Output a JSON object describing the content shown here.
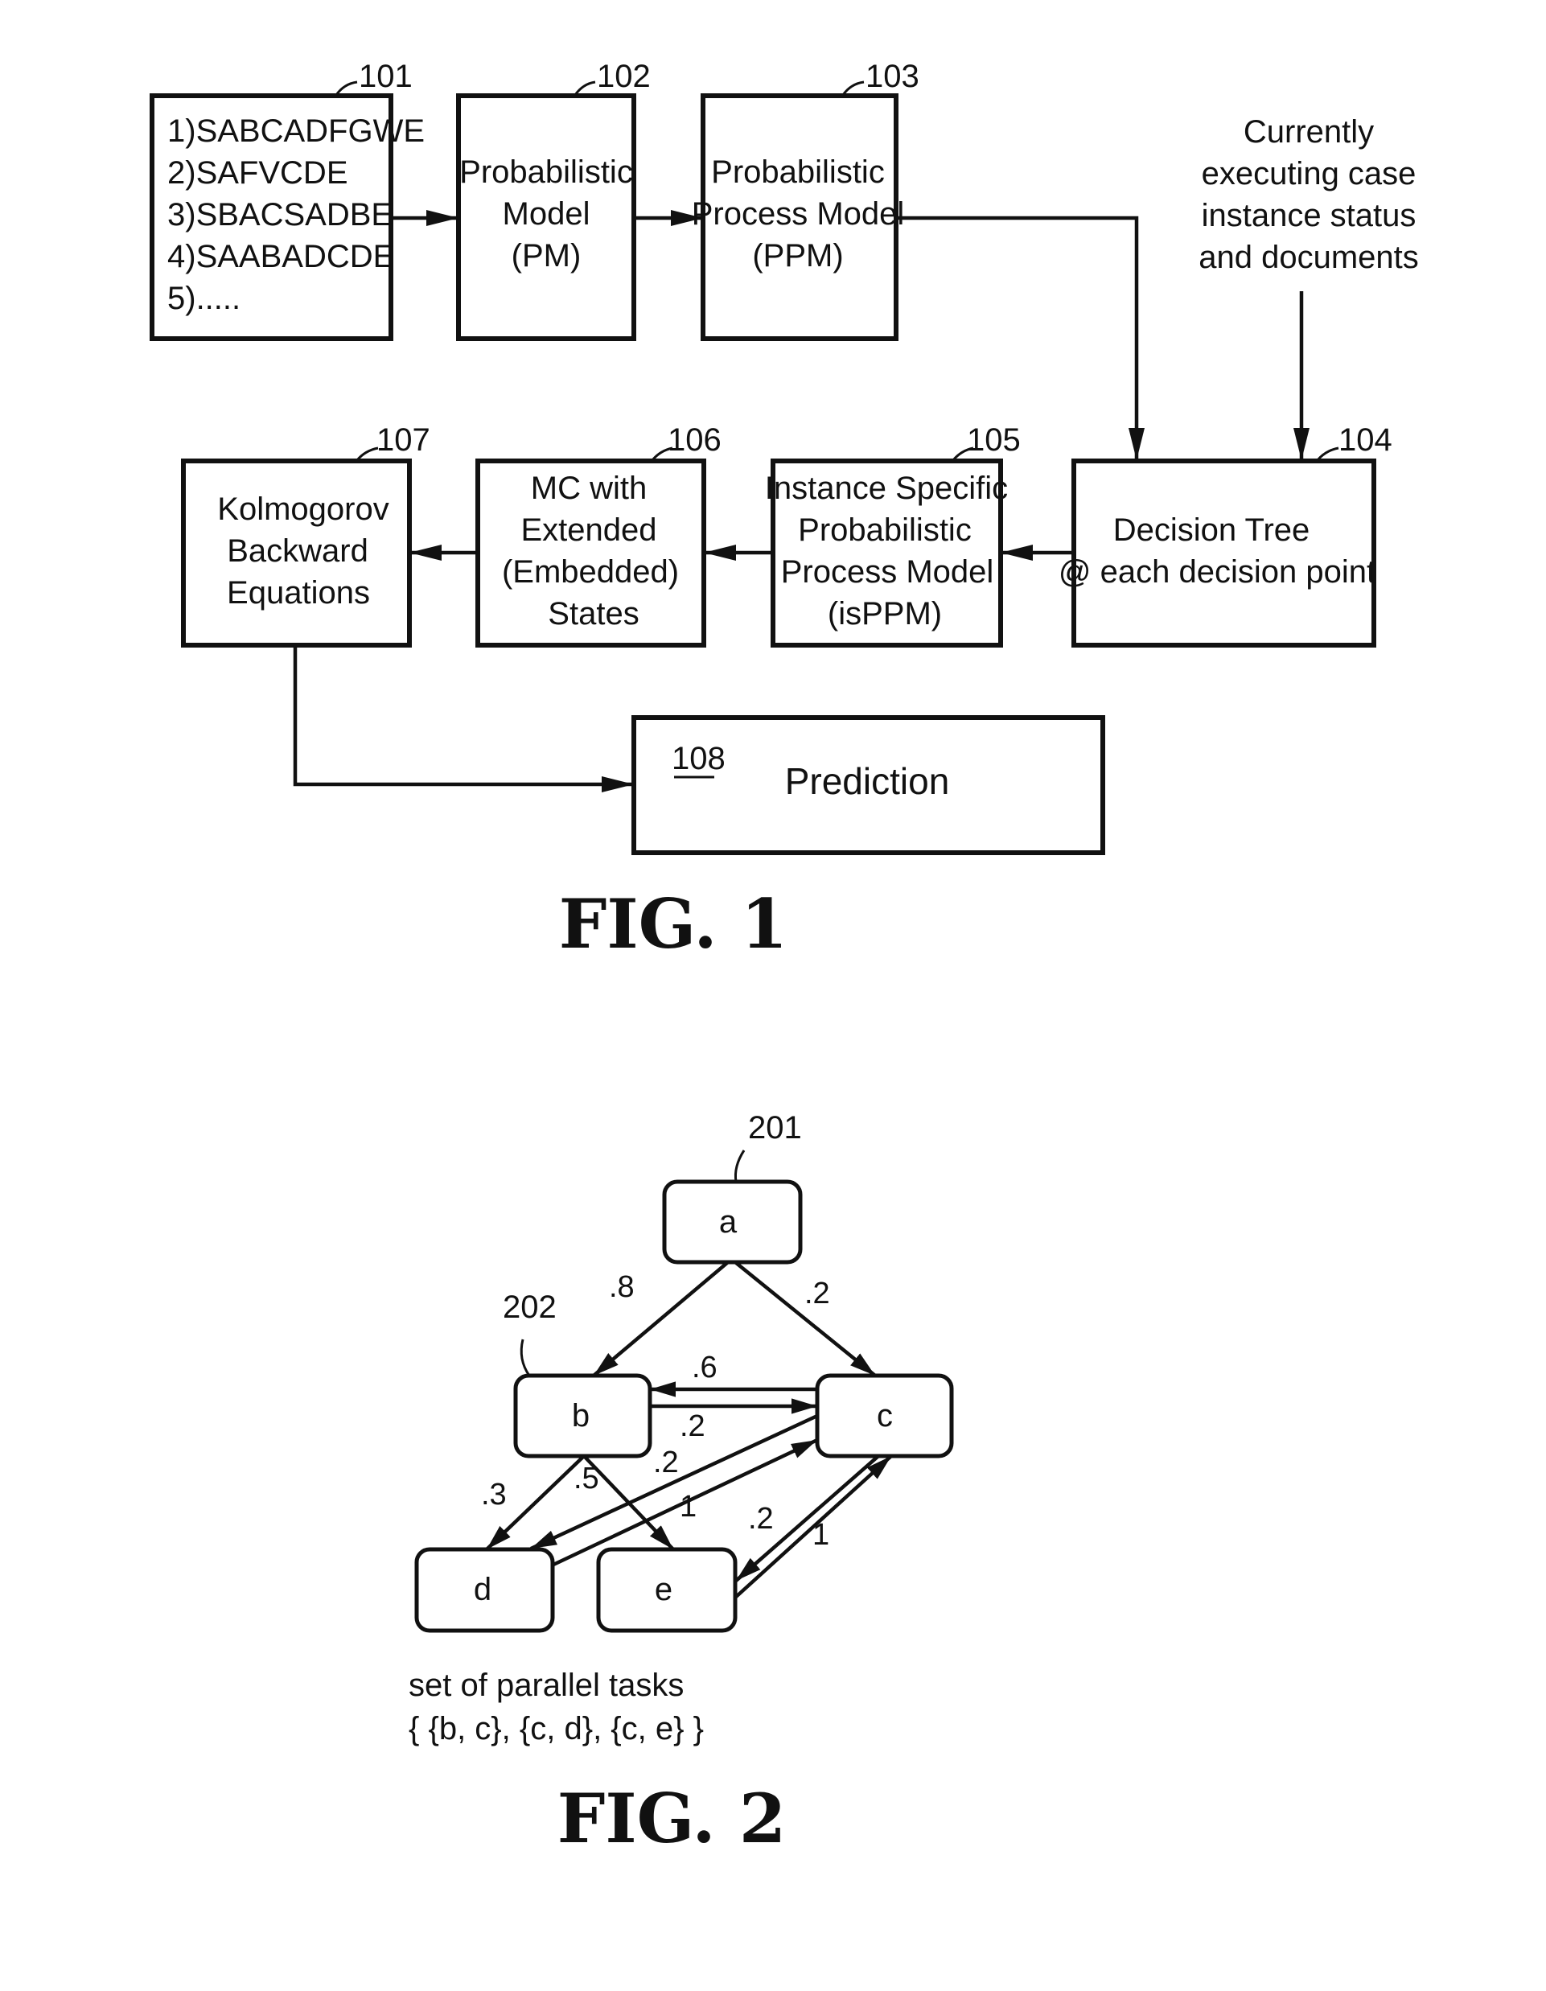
{
  "fig1": {
    "caption": "FIG. 1",
    "boxes": {
      "b101": {
        "ref": "101",
        "lines": [
          "1)SABCADFGWE",
          "2)SAFVCDE",
          "3)SBACSADBE",
          "4)SAABADCDE",
          "5)....."
        ]
      },
      "b102": {
        "ref": "102",
        "lines": [
          "Probabilistic",
          "Model",
          "(PM)"
        ]
      },
      "b103": {
        "ref": "103",
        "lines": [
          "Probabilistic",
          "Process Model",
          "(PPM)"
        ]
      },
      "b104": {
        "ref": "104",
        "lines": [
          "Decision Tree",
          "@ each decision point"
        ]
      },
      "b105": {
        "ref": "105",
        "lines": [
          "Instance Specific",
          "Probabilistic",
          "Process Model",
          "(isPPM)"
        ]
      },
      "b106": {
        "ref": "106",
        "lines": [
          "MC with",
          "Extended",
          "(Embedded)",
          "States"
        ]
      },
      "b107": {
        "ref": "107",
        "lines": [
          "Kolmogorov",
          "Backward",
          "Equations"
        ]
      },
      "b108": {
        "ref": "108",
        "label": "Prediction"
      }
    },
    "external_input": [
      "Currently",
      "executing case",
      "instance status",
      "and documents"
    ]
  },
  "fig2": {
    "caption": "FIG. 2",
    "refs": {
      "r201": "201",
      "r202": "202"
    },
    "nodes": {
      "a": "a",
      "b": "b",
      "c": "c",
      "d": "d",
      "e": "e"
    },
    "edges": [
      {
        "from": "a",
        "to": "b",
        "prob": ".8"
      },
      {
        "from": "a",
        "to": "c",
        "prob": ".2"
      },
      {
        "from": "c",
        "to": "b",
        "prob": ".6"
      },
      {
        "from": "b",
        "to": "c",
        "prob": ".2"
      },
      {
        "from": "b",
        "to": "d",
        "prob": ".3"
      },
      {
        "from": "b",
        "to": "e",
        "prob": ".5"
      },
      {
        "from": "c",
        "to": "d",
        "prob": ".2"
      },
      {
        "from": "d",
        "to": "c",
        "prob": "1"
      },
      {
        "from": "c",
        "to": "e",
        "prob": ".2"
      },
      {
        "from": "e",
        "to": "c",
        "prob": "1"
      }
    ],
    "note": [
      "set of parallel tasks",
      "{ {b, c}, {c, d}, {c, e} }"
    ]
  }
}
